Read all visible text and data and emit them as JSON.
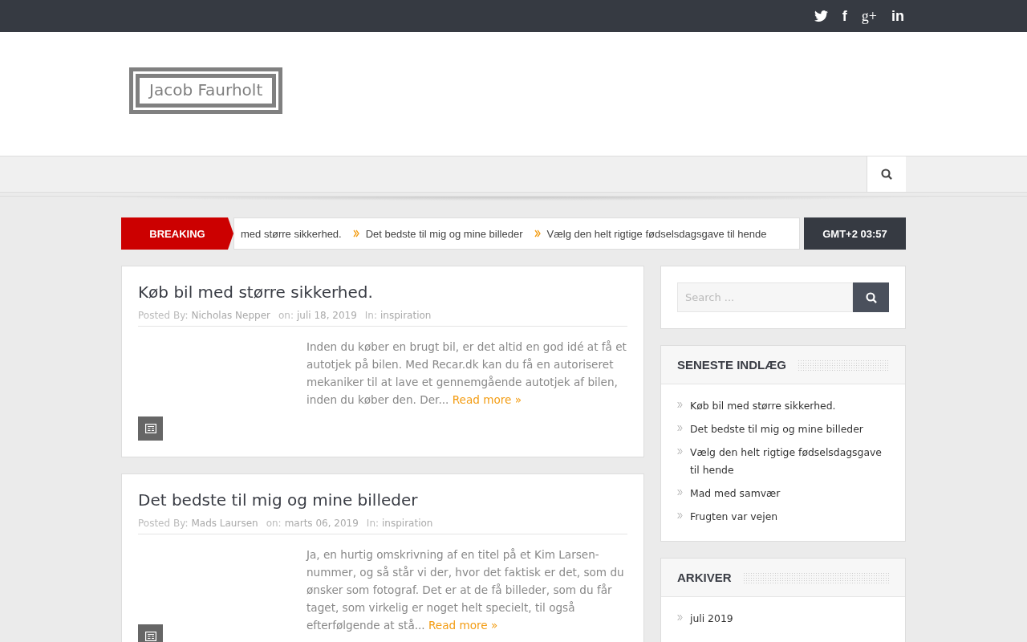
{
  "top_bar": {
    "social": [
      {
        "kind": "twitter"
      },
      {
        "kind": "facebook",
        "glyph": "f"
      },
      {
        "kind": "googleplus",
        "glyph": "g+"
      },
      {
        "kind": "linkedin",
        "glyph": "in"
      }
    ]
  },
  "logo": {
    "text": "Jacob Faurholt"
  },
  "ticker": {
    "label": "BREAKING",
    "items": [
      "med større sikkerhed.",
      "Det bedste til mig og mine billeder",
      "Vælg den helt rigtige fødselsdagsgave til hende"
    ],
    "time": "GMT+2 03:57"
  },
  "posts": [
    {
      "title": "Køb bil med større sikkerhed.",
      "author_label": "Posted By:",
      "author": "Nicholas Nepper",
      "date_label": "on:",
      "date": "juli 18, 2019",
      "category_label": "In:",
      "category": "inspiration",
      "excerpt": "Inden du køber en brugt bil, er det altid en god idé at få et autotjek på bilen. Med Recar.dk kan du få en autoriseret mekaniker til at lave et gennemgående autotjek af bilen, inden du køber den. Der...",
      "read_more": "Read more »"
    },
    {
      "title": "Det bedste til mig og mine billeder",
      "author_label": "Posted By:",
      "author": "Mads Laursen",
      "date_label": "on:",
      "date": "marts 06, 2019",
      "category_label": "In:",
      "category": "inspiration",
      "excerpt": "Ja, en hurtig omskrivning af en titel på et Kim Larsen-nummer, og så står vi der, hvor det faktisk er det, som du ønsker som fotograf. Det er at de få billeder, som du får taget, som virkelig er noget helt specielt, til også efterfølgende at stå...",
      "read_more": "Read more »"
    }
  ],
  "sidebar": {
    "search": {
      "placeholder": "Search ..."
    },
    "widgets": [
      {
        "title": "SENESTE INDLÆG",
        "items": [
          "Køb bil med større sikkerhed.",
          "Det bedste til mig og mine billeder",
          "Vælg den helt rigtige fødselsdagsgave til hende",
          "Mad med samvær",
          "Frugten var vejen"
        ]
      },
      {
        "title": "ARKIVER",
        "items": [
          "juli 2019"
        ]
      }
    ]
  }
}
